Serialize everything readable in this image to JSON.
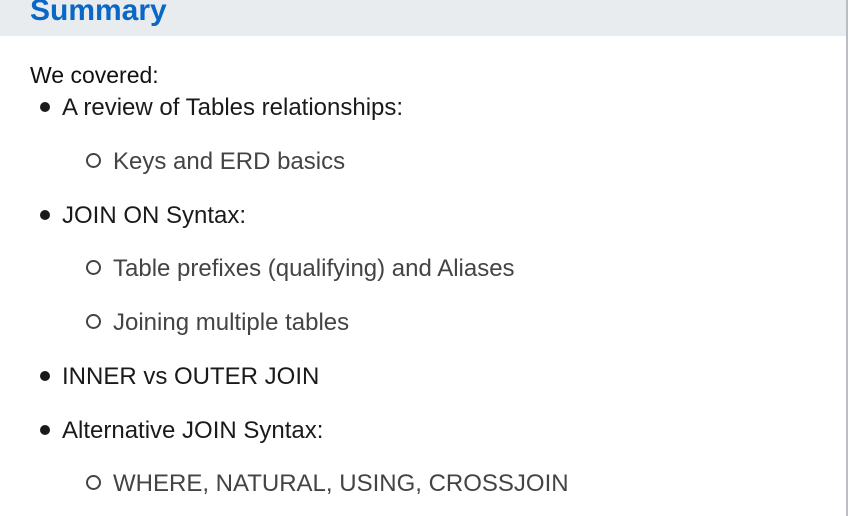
{
  "header": {
    "title": "Summary"
  },
  "content": {
    "intro": "We covered:",
    "items": [
      {
        "level": 1,
        "text": "A review of Tables relationships:"
      },
      {
        "level": 2,
        "text": "Keys and ERD basics"
      },
      {
        "level": 1,
        "text": "JOIN ON Syntax:"
      },
      {
        "level": 2,
        "text": "Table prefixes (qualifying) and Aliases"
      },
      {
        "level": 2,
        "text": "Joining multiple tables"
      },
      {
        "level": 1,
        "text": "INNER vs OUTER JOIN"
      },
      {
        "level": 1,
        "text": "Alternative JOIN Syntax:"
      },
      {
        "level": 2,
        "text": "WHERE, NATURAL, USING, CROSSJOIN"
      }
    ]
  },
  "colors": {
    "title": "#0a67c5",
    "header_band": "#e9ecef",
    "text_primary": "#1a1a1a",
    "text_secondary": "#444444"
  },
  "icons": {
    "level1_bullet": "filled-dot-icon",
    "level2_bullet": "hollow-circle-icon"
  }
}
